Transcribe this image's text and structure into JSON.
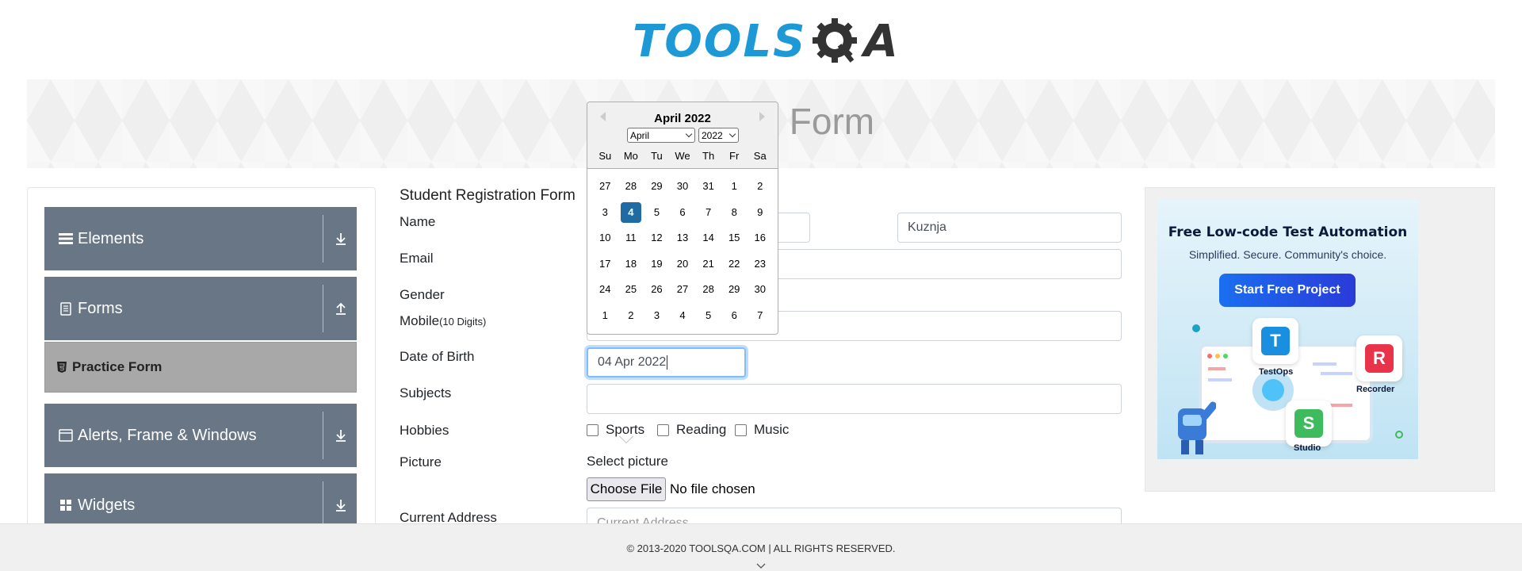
{
  "header": {
    "logo_part1": "TOOLS",
    "logo_part2": "A",
    "logo_icon": "gear-q-icon"
  },
  "banner": {
    "title": "Practice Form"
  },
  "sidebar": {
    "groups": [
      {
        "label": "Elements",
        "icon": "menu-icon",
        "arrow": "download-icon"
      },
      {
        "label": "Forms",
        "icon": "document-icon",
        "arrow": "upload-icon"
      },
      {
        "label": "Alerts, Frame & Windows",
        "icon": "window-icon",
        "arrow": "download-icon"
      },
      {
        "label": "Widgets",
        "icon": "grid-icon",
        "arrow": "download-icon"
      }
    ],
    "active_item": {
      "label": "Practice Form",
      "icon": "html5-icon"
    }
  },
  "form": {
    "title": "Student Registration Form",
    "labels": {
      "name": "Name",
      "email": "Email",
      "gender": "Gender",
      "mobile": "Mobile",
      "mobile_hint": "(10 Digits)",
      "dob": "Date of Birth",
      "subjects": "Subjects",
      "hobbies": "Hobbies",
      "picture": "Picture",
      "address": "Current Address"
    },
    "last_name_value": "Kuznja",
    "dob_value": "04 Apr 2022",
    "address_placeholder": "Current Address",
    "hobbies": [
      "Sports",
      "Reading",
      "Music"
    ],
    "select_picture": "Select picture",
    "choose_file": "Choose File",
    "no_file": "No file chosen"
  },
  "datepicker": {
    "month_title": "April 2022",
    "month_select": "April",
    "year_select": "2022",
    "weekdays": [
      "Su",
      "Mo",
      "Tu",
      "We",
      "Th",
      "Fr",
      "Sa"
    ],
    "weeks": [
      [
        "27",
        "28",
        "29",
        "30",
        "31",
        "1",
        "2"
      ],
      [
        "3",
        "4",
        "5",
        "6",
        "7",
        "8",
        "9"
      ],
      [
        "10",
        "11",
        "12",
        "13",
        "14",
        "15",
        "16"
      ],
      [
        "17",
        "18",
        "19",
        "20",
        "21",
        "22",
        "23"
      ],
      [
        "24",
        "25",
        "26",
        "27",
        "28",
        "29",
        "30"
      ],
      [
        "1",
        "2",
        "3",
        "4",
        "5",
        "6",
        "7"
      ]
    ],
    "selected_day": "4",
    "selected_color": "#216ba5"
  },
  "ad": {
    "title": "Free Low-code Test Automation",
    "subtitle": "Simplified. Secure. Community's choice.",
    "button": "Start Free Project",
    "products": [
      "TestOps",
      "Recorder",
      "Studio"
    ]
  },
  "footer": {
    "text": "© 2013-2020 TOOLSQA.COM | ALL RIGHTS RESERVED."
  },
  "colors": {
    "sidebar_header": "#687685",
    "active_item": "#a8a8a8",
    "logo_blue": "#1d9ad6",
    "focus_border": "#80bdff"
  }
}
